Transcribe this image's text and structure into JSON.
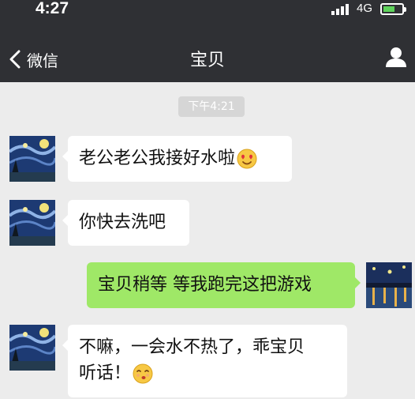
{
  "status_bar": {
    "time": "4:27",
    "network": "4G"
  },
  "nav": {
    "back_label": "微信",
    "title": "宝贝"
  },
  "chat": {
    "timestamp": "下午4:21",
    "messages": [
      {
        "direction": "in",
        "text": "老公老公我接好水啦",
        "emoji": "heart-eyes-emoji"
      },
      {
        "direction": "in",
        "text": "你快去洗吧"
      },
      {
        "direction": "out",
        "text": "宝贝稍等 等我跑完这把游戏"
      },
      {
        "direction": "in",
        "text_line1": "不嘛，一会水不热了，乖宝贝",
        "text_line2": "听话！",
        "emoji": "kissing-emoji"
      }
    ]
  },
  "colors": {
    "header_bg": "#2f3034",
    "chat_bg": "#ececec",
    "outgoing_bubble": "#9fe867",
    "incoming_bubble": "#ffffff"
  }
}
